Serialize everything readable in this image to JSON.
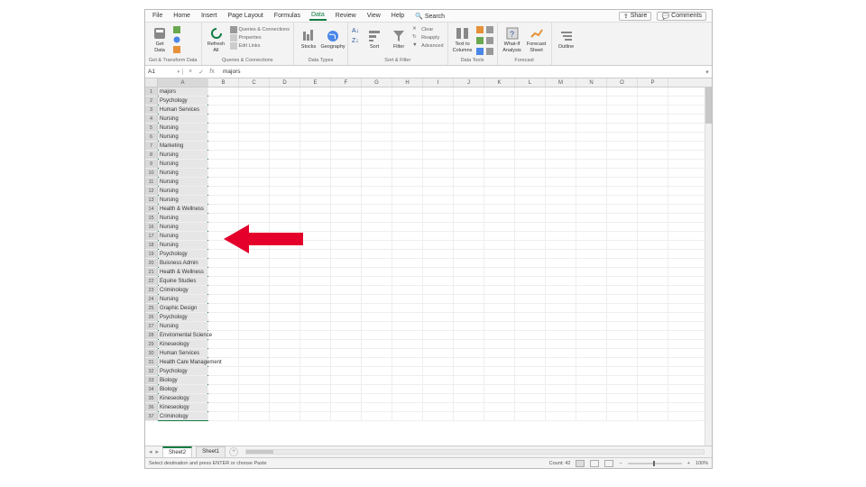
{
  "menu": {
    "items": [
      "File",
      "Home",
      "Insert",
      "Page Layout",
      "Formulas",
      "Data",
      "Review",
      "View",
      "Help"
    ],
    "active": "Data",
    "search_label": "Search",
    "share": "Share",
    "comments": "Comments"
  },
  "ribbon": {
    "groups": [
      {
        "label": "Get & Transform Data",
        "big": [
          {
            "name": "get-data",
            "label": "Get\nData"
          }
        ],
        "small": []
      },
      {
        "label": "Queries & Connections",
        "big": [
          {
            "name": "refresh-all",
            "label": "Refresh\nAll"
          }
        ],
        "small": [
          "Queries & Connections",
          "Properties",
          "Edit Links"
        ]
      },
      {
        "label": "Data Types",
        "big": [
          {
            "name": "stocks",
            "label": "Stocks"
          },
          {
            "name": "geography",
            "label": "Geography"
          }
        ],
        "small": []
      },
      {
        "label": "Sort & Filter",
        "big": [
          {
            "name": "sort",
            "label": "Sort"
          },
          {
            "name": "filter",
            "label": "Filter"
          }
        ],
        "small": [
          "Clear",
          "Reapply",
          "Advanced"
        ]
      },
      {
        "label": "Data Tools",
        "big": [
          {
            "name": "text-to-columns",
            "label": "Text to\nColumns"
          }
        ],
        "small": []
      },
      {
        "label": "Forecast",
        "big": [
          {
            "name": "whatif",
            "label": "What-If\nAnalysis"
          },
          {
            "name": "forecast-sheet",
            "label": "Forecast\nSheet"
          }
        ],
        "small": []
      },
      {
        "label": "",
        "big": [
          {
            "name": "outline",
            "label": "Outline"
          }
        ],
        "small": []
      }
    ]
  },
  "formula_bar": {
    "name_box": "A1",
    "formula": "majors"
  },
  "columns": [
    "A",
    "B",
    "C",
    "D",
    "E",
    "F",
    "G",
    "H",
    "I",
    "J",
    "K",
    "L",
    "M",
    "N",
    "O",
    "P"
  ],
  "cells_colA": [
    "majors",
    "Psychology",
    "Human Services",
    "Nursing",
    "Nursing",
    "Nursing",
    "Marketing",
    "Nursing",
    "Nursing",
    "Nursing",
    "Nursing",
    "Nursing",
    "Nursing",
    "Health & Wellness",
    "Nursing",
    "Nursing",
    "Nursing",
    "Nursing",
    "Psychology",
    "Buisness Admin",
    "Health & Wellness",
    "Equine Studies",
    "Criminology",
    "Nursing",
    "Graphic Design",
    "Psychology",
    "Nursing",
    "Enviromental Science",
    "Kineseology",
    "Human Services",
    "Health Care Management",
    "Psychology",
    "Biology",
    "Biology",
    "Kineseology",
    "Kineseology",
    "Criminology"
  ],
  "sheets": {
    "tabs": [
      "Sheet2",
      "Sheet1"
    ],
    "active": "Sheet2"
  },
  "status": {
    "message": "Select destination and press ENTER or choose Paste",
    "count_label": "Count:",
    "count": "42",
    "zoom": "100%"
  }
}
